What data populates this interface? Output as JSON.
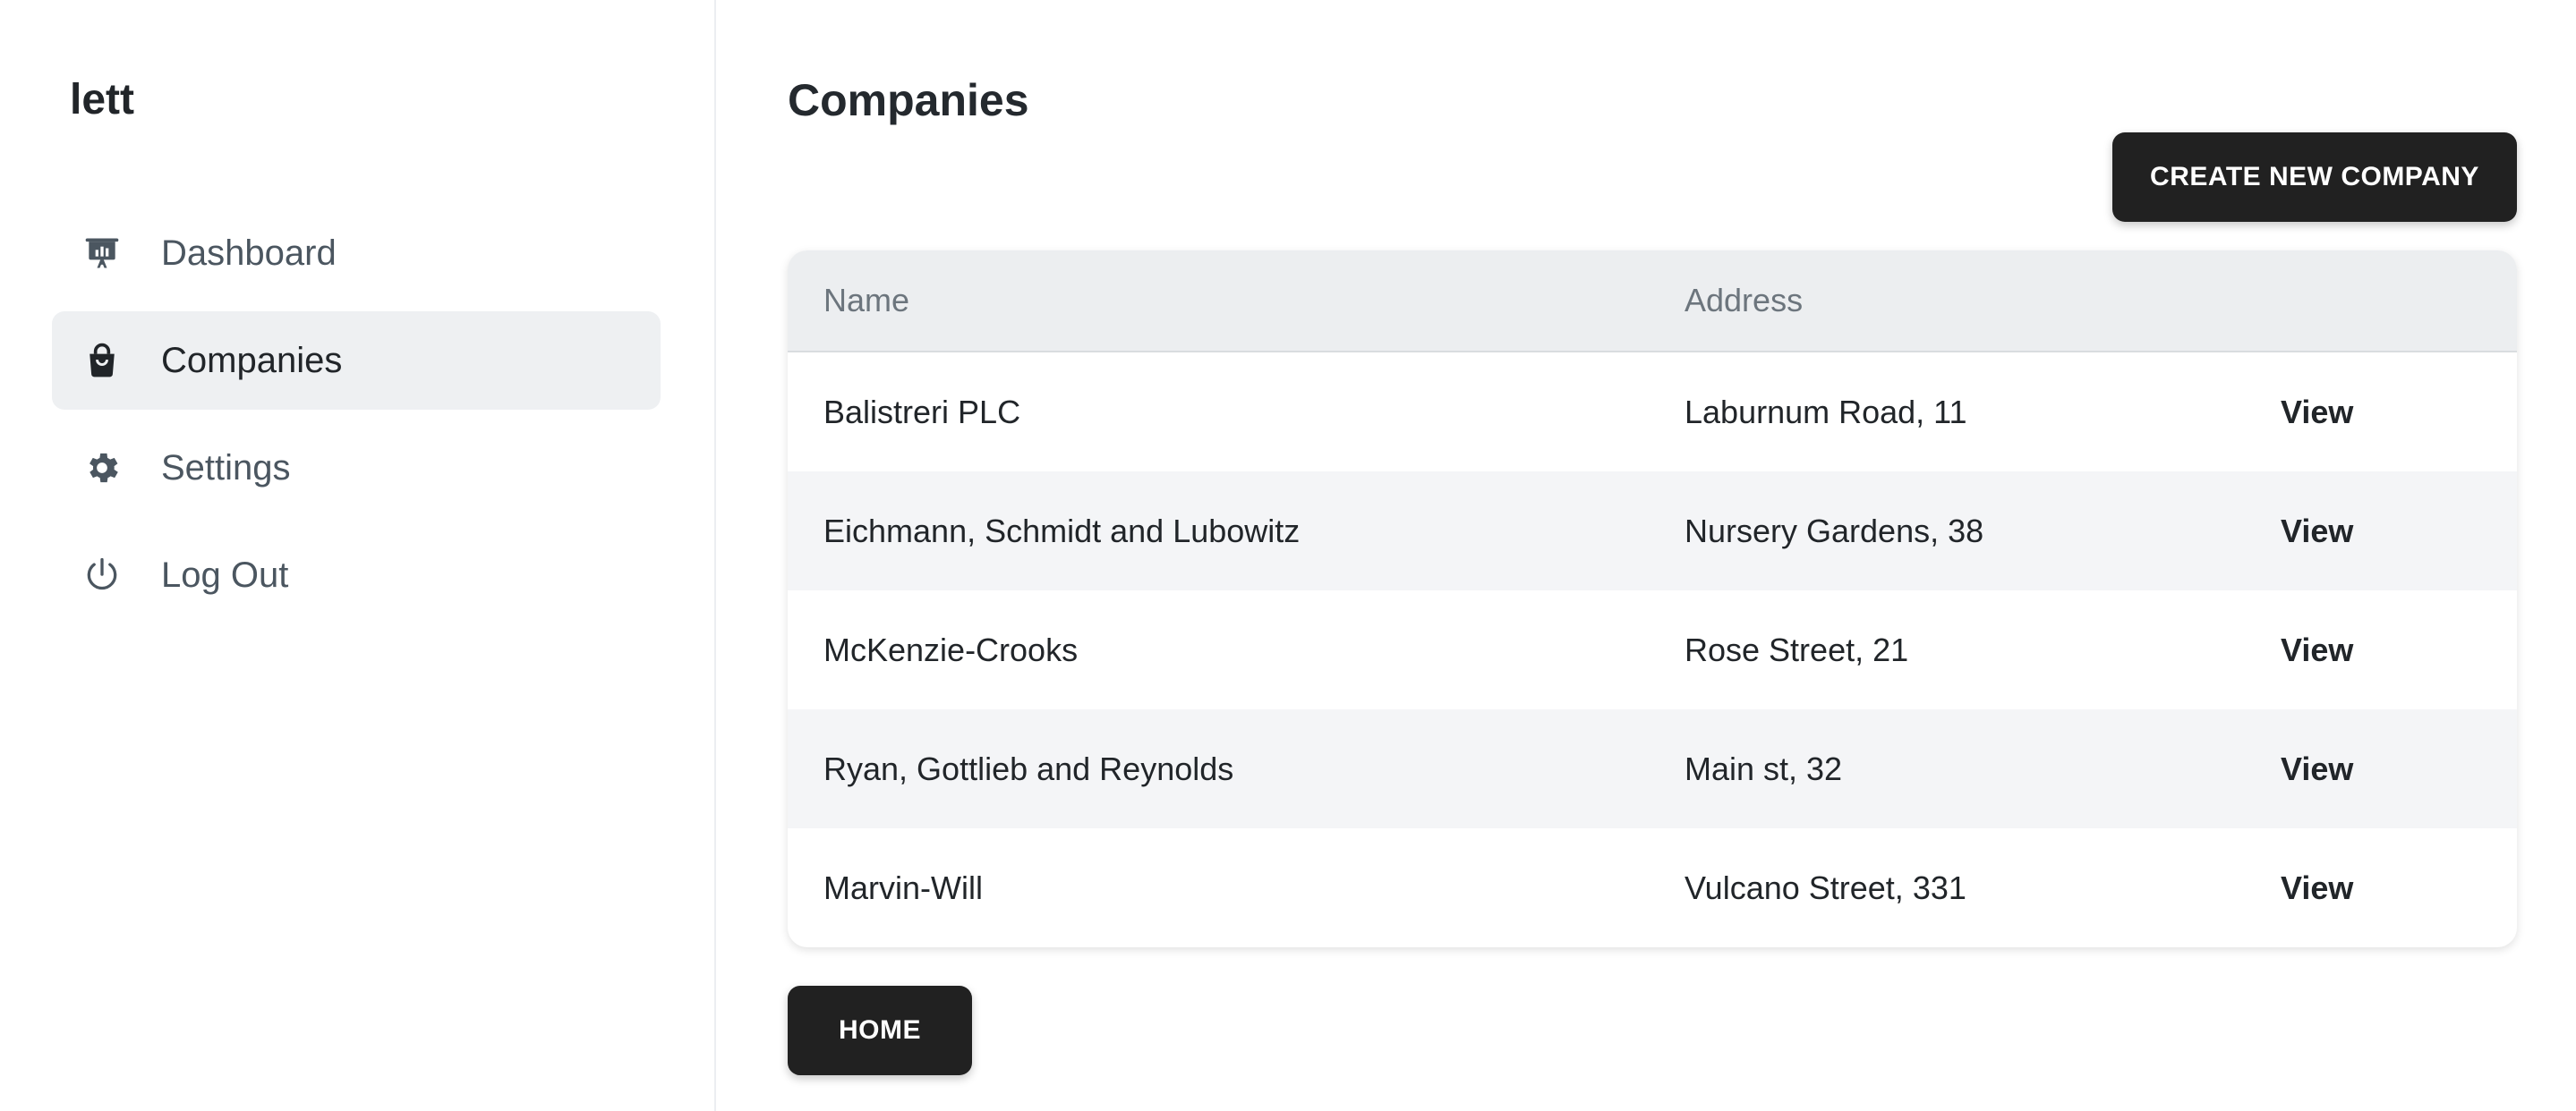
{
  "app": {
    "brand": "lett"
  },
  "sidebar": {
    "items": [
      {
        "label": "Dashboard",
        "icon": "presentation-chart-icon",
        "active": false
      },
      {
        "label": "Companies",
        "icon": "shopping-bag-icon",
        "active": true
      },
      {
        "label": "Settings",
        "icon": "gear-icon",
        "active": false
      },
      {
        "label": "Log Out",
        "icon": "power-icon",
        "active": false
      }
    ]
  },
  "main": {
    "title": "Companies",
    "create_button_label": "CREATE NEW COMPANY",
    "home_button_label": "HOME",
    "table": {
      "headers": {
        "name": "Name",
        "address": "Address",
        "action": ""
      },
      "rows": [
        {
          "name": "Balistreri PLC",
          "address": "Laburnum Road, 11",
          "action": "View"
        },
        {
          "name": "Eichmann, Schmidt and Lubowitz",
          "address": "Nursery Gardens, 38",
          "action": "View"
        },
        {
          "name": "McKenzie-Crooks",
          "address": "Rose Street, 21",
          "action": "View"
        },
        {
          "name": "Ryan, Gottlieb and Reynolds",
          "address": "Main st, 32",
          "action": "View"
        },
        {
          "name": "Marvin-Will",
          "address": "Vulcano Street, 331",
          "action": "View"
        }
      ]
    }
  },
  "colors": {
    "button_bg": "#212121",
    "active_nav_bg": "#eef0f2",
    "table_header_bg": "#eceef0",
    "striped_row_bg": "#f4f5f7"
  }
}
